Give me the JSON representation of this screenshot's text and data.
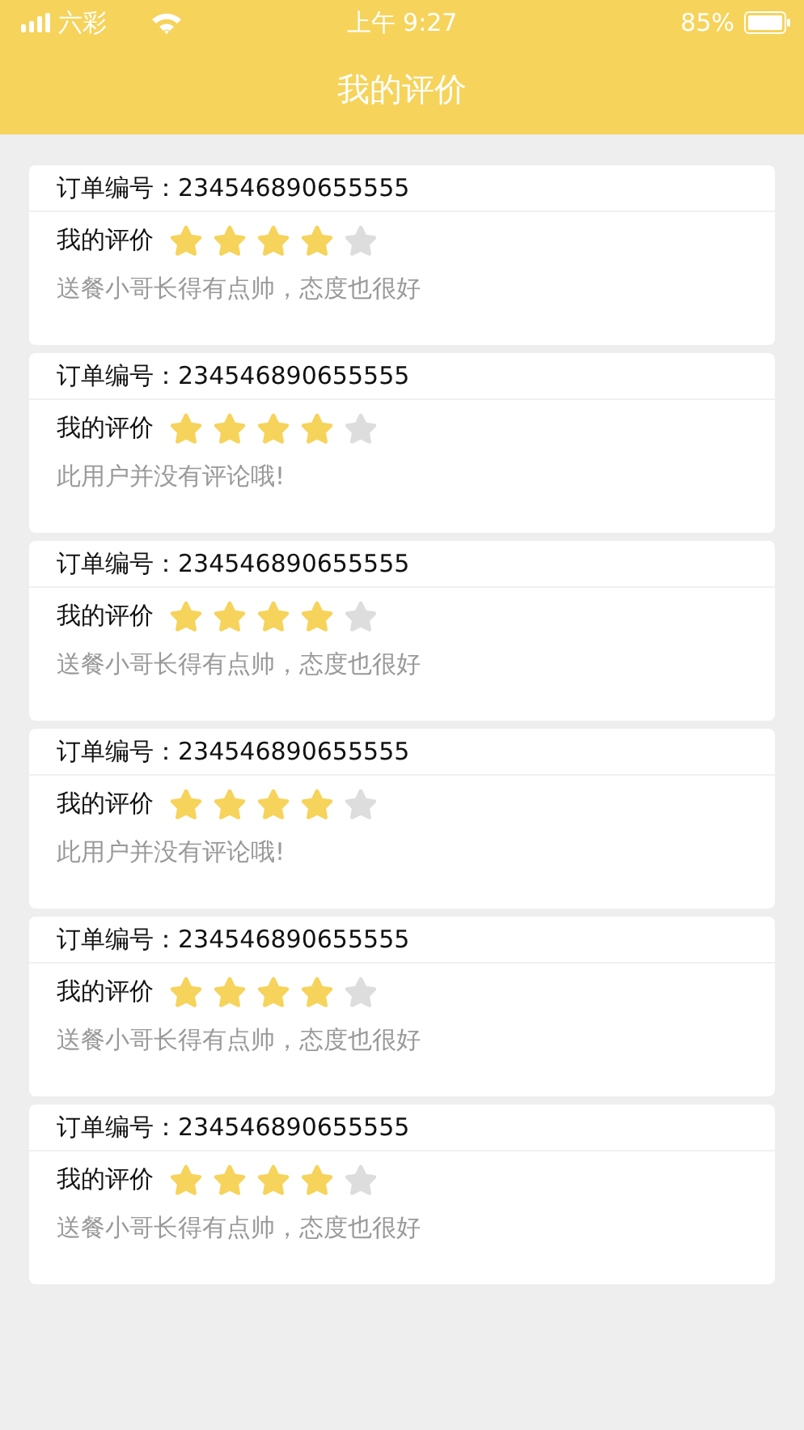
{
  "status_bar": {
    "carrier": "六彩",
    "time": "上午 9:27",
    "battery": "85%"
  },
  "nav_bar": {
    "title": "我的评价"
  },
  "reviews": [
    {
      "order": "订单编号：234546890655555",
      "rating_label": "我的评价",
      "stars": 4,
      "comment": "送餐小哥长得有点帅，态度也很好"
    },
    {
      "order": "订单编号：234546890655555",
      "rating_label": "我的评价",
      "stars": 4,
      "comment": "此用户并没有评论哦!"
    },
    {
      "order": "订单编号：234546890655555",
      "rating_label": "我的评价",
      "stars": 4,
      "comment": "送餐小哥长得有点帅，态度也很好"
    },
    {
      "order": "订单编号：234546890655555",
      "rating_label": "我的评价",
      "stars": 4,
      "comment": "此用户并没有评论哦!"
    },
    {
      "order": "订单编号：234546890655555",
      "rating_label": "我的评价",
      "stars": 4,
      "comment": "送餐小哥长得有点帅，态度也很好"
    },
    {
      "order": "订单编号：234546890655555",
      "rating_label": "我的评价",
      "stars": 4,
      "comment": "送餐小哥长得有点帅，态度也很好"
    }
  ]
}
